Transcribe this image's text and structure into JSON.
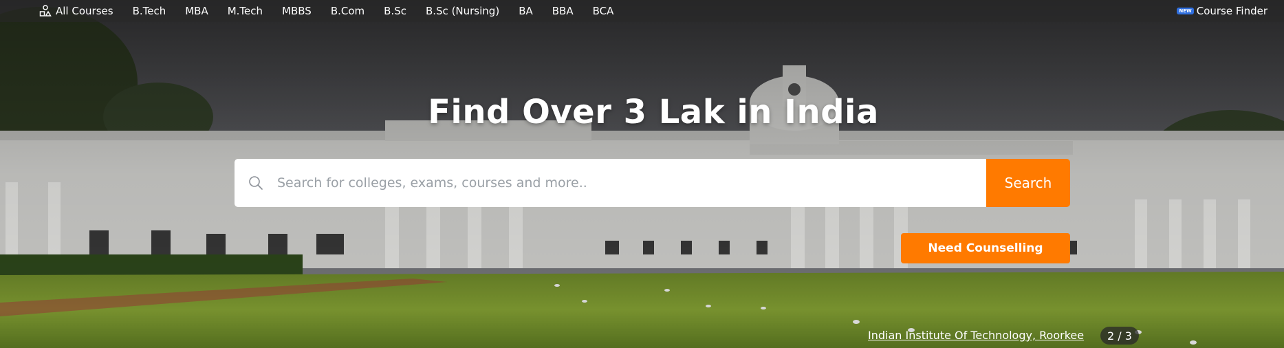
{
  "nav": {
    "all_courses": "All Courses",
    "items": [
      "B.Tech",
      "MBA",
      "M.Tech",
      "MBBS",
      "B.Com",
      "B.Sc",
      "B.Sc (Nursing)",
      "BA",
      "BBA",
      "BCA"
    ],
    "finder_badge": "NEW",
    "finder_label": "Course Finder"
  },
  "hero": {
    "title": "Find Over 3 Lak in India",
    "search_placeholder": "Search for colleges, exams, courses and more..",
    "search_value": "",
    "search_button": "Search",
    "counselling_button": "Need Counselling",
    "caption": "Indian Institute Of Technology, Roorkee",
    "slide_counter": "2 / 3"
  },
  "colors": {
    "accent": "#ff7a00",
    "badge": "#2f6fe0",
    "nav_bg": "#282828"
  },
  "icons": {
    "all_courses": "course-grid-icon",
    "search": "search-icon"
  }
}
